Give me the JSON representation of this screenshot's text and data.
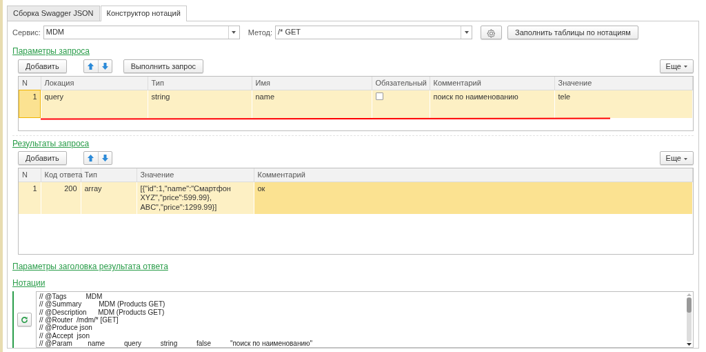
{
  "tabs": [
    {
      "label": "Сборка Swagger JSON",
      "selected": false
    },
    {
      "label": "Конструктор нотаций",
      "selected": true
    }
  ],
  "service": {
    "label": "Сервис:",
    "value": "MDM"
  },
  "method": {
    "label": "Метод:",
    "value": "/* GET"
  },
  "fill_button": "Заполнить таблицы по нотациям",
  "request_params": {
    "title": "Параметры запроса",
    "add_button": "Добавить",
    "run_button": "Выполнить запрос",
    "more_button": "Еще",
    "columns": [
      {
        "label": "N",
        "focused": true
      },
      {
        "label": "Локация",
        "focused": false
      },
      {
        "label": "Тип",
        "focused": false
      },
      {
        "label": "Имя",
        "focused": false
      },
      {
        "label": "Обязательный",
        "focused": false
      },
      {
        "label": "Комментарий",
        "focused": false
      },
      {
        "label": "Значение",
        "focused": false
      }
    ],
    "rows": [
      {
        "n": "1",
        "location": "query",
        "type": "string",
        "name": "name",
        "required": false,
        "comment": "поиск по наименованию",
        "value": "tele",
        "selected": true
      }
    ]
  },
  "request_results": {
    "title": "Результаты запроса",
    "add_button": "Добавить",
    "more_button": "Еще",
    "columns": [
      {
        "label": "N",
        "focused": false
      },
      {
        "label": "Код ответа",
        "focused": false
      },
      {
        "label": "Тип",
        "focused": false
      },
      {
        "label": "Значение",
        "focused": false
      },
      {
        "label": "Комментарий",
        "focused": true
      }
    ],
    "rows": [
      {
        "n": "1",
        "code": "200",
        "type": "array",
        "value": [
          "[{\"id\":1,\"name\":\"Смартфон",
          "XYZ\",\"price\":599.99},",
          " ABC\",\"price\":1299.99}]"
        ],
        "comment": "ок",
        "selected": true
      }
    ]
  },
  "response_headers": {
    "title": "Параметры заголовка результата ответа"
  },
  "notations": {
    "title": "Нотации",
    "lines": [
      "// @Tags          MDM",
      "// @Summary         MDM (Products GET)",
      "// @Description      MDM (Products GET)",
      "// @Router  /mdm/* [GET]",
      "// @Produce json",
      "// @Accept  json",
      "// @Param        name          query          string          false          \"поиск по наименованию\""
    ]
  }
}
